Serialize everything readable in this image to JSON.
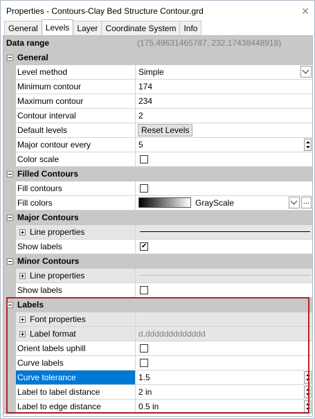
{
  "window": {
    "title": "Properties - Contours-Clay Bed Structure Contour.grd",
    "close_glyph": "✕"
  },
  "tabs": [
    {
      "label": "General"
    },
    {
      "label": "Levels",
      "active": true
    },
    {
      "label": "Layer"
    },
    {
      "label": "Coordinate System"
    },
    {
      "label": "Info"
    }
  ],
  "data_range": {
    "label": "Data range",
    "value": "(175.49631465787, 232.17438448918)"
  },
  "general": {
    "title": "General",
    "level_method": {
      "label": "Level method",
      "value": "Simple"
    },
    "min_contour": {
      "label": "Minimum contour",
      "value": "174"
    },
    "max_contour": {
      "label": "Maximum contour",
      "value": "234"
    },
    "contour_interval": {
      "label": "Contour interval",
      "value": "2"
    },
    "default_levels": {
      "label": "Default levels",
      "button": "Reset Levels"
    },
    "major_every": {
      "label": "Major contour every",
      "value": "5"
    },
    "color_scale": {
      "label": "Color scale",
      "checked": false
    }
  },
  "filled": {
    "title": "Filled Contours",
    "fill_contours": {
      "label": "Fill contours",
      "checked": false
    },
    "fill_colors": {
      "label": "Fill colors",
      "value": "GrayScale",
      "ellipsis": "..."
    }
  },
  "major": {
    "title": "Major Contours",
    "line_properties": {
      "label": "Line properties"
    },
    "show_labels": {
      "label": "Show labels",
      "checked": true,
      "mark": "✔"
    }
  },
  "minor": {
    "title": "Minor Contours",
    "line_properties": {
      "label": "Line properties"
    },
    "show_labels": {
      "label": "Show labels",
      "checked": false
    }
  },
  "labels": {
    "title": "Labels",
    "font_properties": {
      "label": "Font properties"
    },
    "label_format": {
      "label": "Label format",
      "value": "d.ddddddddddddd"
    },
    "orient_uphill": {
      "label": "Orient labels uphill",
      "checked": false
    },
    "curve_labels": {
      "label": "Curve labels",
      "checked": false
    },
    "curve_tolerance": {
      "label": "Curve tolerance",
      "value": "1.5"
    },
    "label_to_label": {
      "label": "Label to label distance",
      "value": "2 in"
    },
    "label_to_edge": {
      "label": "Label to edge distance",
      "value": "0.5 in"
    }
  },
  "colors": {
    "selection": "#0078d7",
    "highlight_border": "#b0272c",
    "category_bg": "#c8c8c8"
  }
}
